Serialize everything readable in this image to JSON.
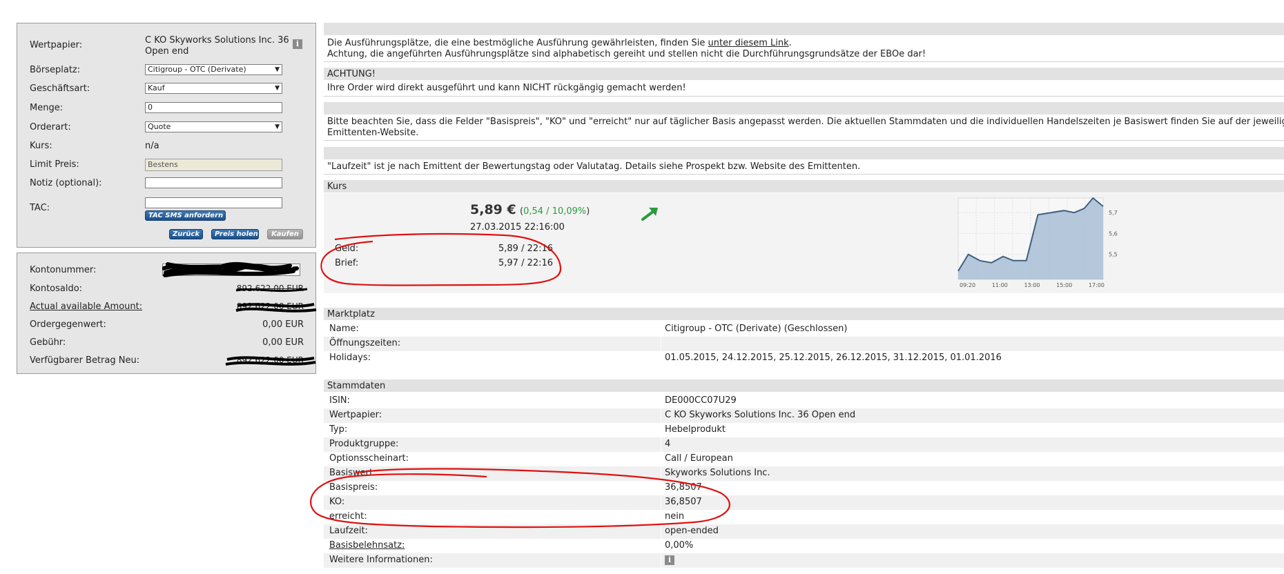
{
  "order": {
    "wertpapier_label": "Wertpapier:",
    "wertpapier_value": "C KO Skyworks Solutions Inc. 36 Open end",
    "wertpapier_value_l1": "C KO Skyworks Solutions Inc. 36",
    "wertpapier_value_l2": "Open end",
    "boerseplatz_label": "Börseplatz:",
    "boerseplatz_value": "Citigroup - OTC (Derivate)",
    "geschaeftsart_label": "Geschäftsart:",
    "geschaeftsart_value": "Kauf",
    "menge_label": "Menge:",
    "menge_value": "0",
    "orderart_label": "Orderart:",
    "orderart_value": "Quote",
    "kurs_label": "Kurs:",
    "kurs_value": "n/a",
    "limit_label": "Limit Preis:",
    "limit_value": "Bestens",
    "notiz_label": "Notiz (optional):",
    "notiz_value": "",
    "tac_label": "TAC:",
    "tac_value": "",
    "tac_button": "TAC SMS anfordern",
    "zurueck_button": "Zurück",
    "preis_button": "Preis holen",
    "kaufen_button": "Kaufen"
  },
  "account": {
    "kontonummer_label": "Kontonummer:",
    "kontosaldo_label": "Kontosaldo:",
    "kontosaldo_value": "892.622,00 EUR",
    "actual_label": "Actual available Amount:",
    "actual_value": "892.622,00 EUR",
    "ordergegenwert_label": "Ordergegenwert:",
    "ordergegenwert_value": "0,00 EUR",
    "gebuehr_label": "Gebühr:",
    "gebuehr_value": "0,00 EUR",
    "verfuegbar_label": "Verfügbarer Betrag Neu:",
    "verfuegbar_value": "892.622,00 EUR"
  },
  "notices": {
    "line1_prefix": "Die Ausführungsplätze, die eine bestmögliche Ausführung gewährleisten, finden Sie ",
    "line1_link": "unter diesem Link",
    "line1_suffix": ".",
    "line2": "Achtung, die angeführten Ausführungsplätze sind alphabetisch gereiht und stellen nicht die Durchführungsgrundsätze der EBOe dar!",
    "achtung_title": "ACHTUNG!",
    "achtung_text": "Ihre Order wird direkt ausgeführt und kann NICHT rückgängig gemacht werden!",
    "basis_text_l1": "Bitte beachten Sie, dass die Felder \"Basispreis\", \"KO\" und \"erreicht\" nur auf täglicher Basis angepasst werden. Die aktuellen Stammdaten und die individuellen Handelszeiten je Basiswert finden Sie auf der jeweiligen",
    "basis_text_l2": "Emittenten-Website.",
    "laufzeit_text": "\"Laufzeit\" ist je nach Emittent der Bewertungstag oder Valutatag. Details siehe Prospekt bzw. Website des Emittenten."
  },
  "kurs": {
    "title": "Kurs",
    "price": "5,89 €",
    "change_open": "(",
    "change_abs": "0,54",
    "change_sep": " / ",
    "change_pct": "10,09%",
    "change_close": ")",
    "timestamp": "27.03.2015 22:16:00",
    "geld_label": "Geld:",
    "geld_value": "5,89 / 22:16",
    "brief_label": "Brief:",
    "brief_value": "5,97 / 22:16",
    "up_color": "#2a9a3c",
    "trend_icon": "arrow-up-right-icon"
  },
  "chart_data": {
    "type": "area",
    "x_ticks": [
      "09:20",
      "11:00",
      "13:00",
      "15:00",
      "17:00"
    ],
    "y_ticks": [
      "5,7",
      "5,6",
      "5,5"
    ],
    "ylim": [
      5.38,
      5.77
    ],
    "x": [
      0.0,
      0.07,
      0.15,
      0.23,
      0.31,
      0.38,
      0.47,
      0.55,
      0.64,
      0.73,
      0.8,
      0.87,
      0.93,
      1.0
    ],
    "values": [
      5.42,
      5.5,
      5.47,
      5.46,
      5.49,
      5.47,
      5.47,
      5.69,
      5.7,
      5.71,
      5.7,
      5.72,
      5.77,
      5.73
    ],
    "grid": true,
    "color": "#3f5f80"
  },
  "marktplatz": {
    "title": "Marktplatz",
    "rows": [
      {
        "k": "Name:",
        "v": "Citigroup - OTC (Derivate) (Geschlossen)"
      },
      {
        "k": "Öffnungszeiten:",
        "v": ""
      },
      {
        "k": "Holidays:",
        "v": "01.05.2015, 24.12.2015, 25.12.2015, 26.12.2015, 31.12.2015, 01.01.2016"
      }
    ]
  },
  "stammdaten": {
    "title": "Stammdaten",
    "rows": [
      {
        "k": "ISIN:",
        "v": "DE000CC07U29"
      },
      {
        "k": "Wertpapier:",
        "v": "C KO Skyworks Solutions Inc. 36 Open end"
      },
      {
        "k": "Typ:",
        "v": "Hebelprodukt"
      },
      {
        "k": "Produktgruppe:",
        "v": "4"
      },
      {
        "k": "Optionsscheinart:",
        "v": "Call / European"
      },
      {
        "k": "Basiswert:",
        "v": "Skyworks Solutions Inc."
      },
      {
        "k": "Basispreis:",
        "v": "36,8507"
      },
      {
        "k": "KO:",
        "v": "36,8507"
      },
      {
        "k": "erreicht:",
        "v": "nein"
      },
      {
        "k": "Laufzeit:",
        "v": "open-ended"
      },
      {
        "k": "Basisbelehnsatz:",
        "v": "0,00%"
      },
      {
        "k": "Weitere Informationen:",
        "v": ""
      }
    ]
  },
  "annotation_color": "#e01010"
}
